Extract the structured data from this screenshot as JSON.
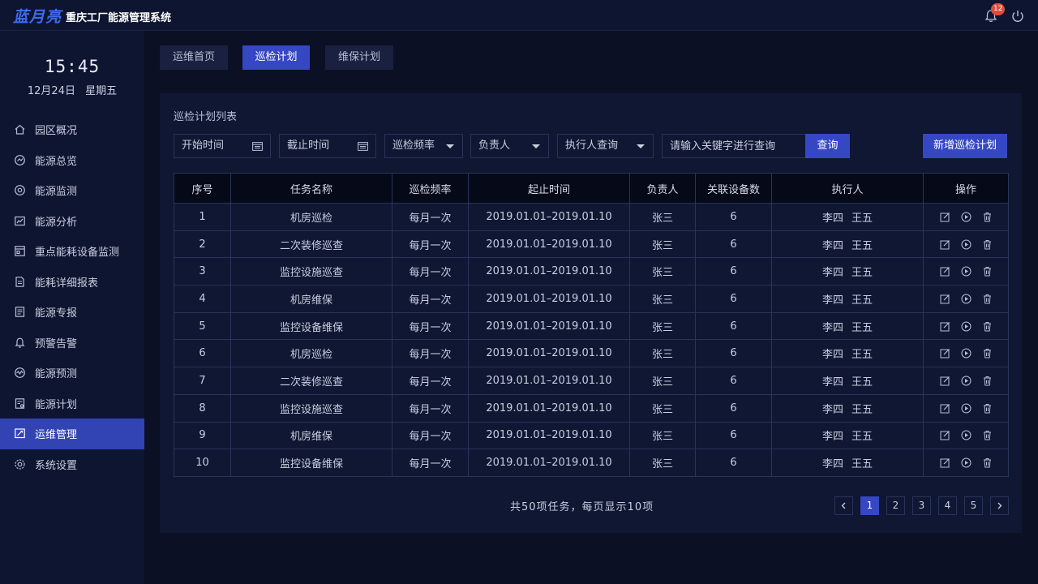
{
  "header": {
    "logo": "蓝月亮",
    "title": "重庆工厂能源管理系统",
    "notification_count": "12"
  },
  "sidebar": {
    "clock": "15:45",
    "date": "12月24日 星期五",
    "items": [
      {
        "label": "园区概况",
        "icon": "home-icon",
        "active": false
      },
      {
        "label": "能源总览",
        "icon": "overview-icon",
        "active": false
      },
      {
        "label": "能源监测",
        "icon": "monitor-icon",
        "active": false
      },
      {
        "label": "能源分析",
        "icon": "analysis-icon",
        "active": false
      },
      {
        "label": "重点能耗设备监测",
        "icon": "equipment-icon",
        "active": false
      },
      {
        "label": "能耗详细报表",
        "icon": "report-icon",
        "active": false
      },
      {
        "label": "能源专报",
        "icon": "doc-icon",
        "active": false
      },
      {
        "label": "预警告警",
        "icon": "alarm-icon",
        "active": false
      },
      {
        "label": "能源预测",
        "icon": "forecast-icon",
        "active": false
      },
      {
        "label": "能源计划",
        "icon": "plan-icon",
        "active": false
      },
      {
        "label": "运维管理",
        "icon": "maintenance-icon",
        "active": true
      },
      {
        "label": "系统设置",
        "icon": "settings-icon",
        "active": false
      }
    ]
  },
  "tabs": [
    {
      "label": "运维首页",
      "active": false
    },
    {
      "label": "巡检计划",
      "active": true
    },
    {
      "label": "维保计划",
      "active": false
    }
  ],
  "panel": {
    "title": "巡检计划列表",
    "filters": {
      "start_time": "开始时间",
      "end_time": "截止时间",
      "frequency": "巡检频率",
      "owner": "负责人",
      "executor": "执行人查询",
      "search_placeholder": "请输入关键字进行查询",
      "search_button": "查询",
      "add_button": "新增巡检计划"
    },
    "table": {
      "headers": [
        "序号",
        "任务名称",
        "巡检频率",
        "起止时间",
        "负责人",
        "关联设备数",
        "执行人",
        "操作"
      ],
      "rows": [
        {
          "no": "1",
          "name": "机房巡检",
          "freq": "每月一次",
          "period": "2019.01.01–2019.01.10",
          "owner": "张三",
          "devices": "6",
          "executors": [
            "李四",
            "王五"
          ]
        },
        {
          "no": "2",
          "name": "二次装修巡查",
          "freq": "每月一次",
          "period": "2019.01.01–2019.01.10",
          "owner": "张三",
          "devices": "6",
          "executors": [
            "李四",
            "王五"
          ]
        },
        {
          "no": "3",
          "name": "监控设施巡查",
          "freq": "每月一次",
          "period": "2019.01.01–2019.01.10",
          "owner": "张三",
          "devices": "6",
          "executors": [
            "李四",
            "王五"
          ]
        },
        {
          "no": "4",
          "name": "机房维保",
          "freq": "每月一次",
          "period": "2019.01.01–2019.01.10",
          "owner": "张三",
          "devices": "6",
          "executors": [
            "李四",
            "王五"
          ]
        },
        {
          "no": "5",
          "name": "监控设备维保",
          "freq": "每月一次",
          "period": "2019.01.01–2019.01.10",
          "owner": "张三",
          "devices": "6",
          "executors": [
            "李四",
            "王五"
          ]
        },
        {
          "no": "6",
          "name": "机房巡检",
          "freq": "每月一次",
          "period": "2019.01.01–2019.01.10",
          "owner": "张三",
          "devices": "6",
          "executors": [
            "李四",
            "王五"
          ]
        },
        {
          "no": "7",
          "name": "二次装修巡查",
          "freq": "每月一次",
          "period": "2019.01.01–2019.01.10",
          "owner": "张三",
          "devices": "6",
          "executors": [
            "李四",
            "王五"
          ]
        },
        {
          "no": "8",
          "name": "监控设施巡查",
          "freq": "每月一次",
          "period": "2019.01.01–2019.01.10",
          "owner": "张三",
          "devices": "6",
          "executors": [
            "李四",
            "王五"
          ]
        },
        {
          "no": "9",
          "name": "机房维保",
          "freq": "每月一次",
          "period": "2019.01.01–2019.01.10",
          "owner": "张三",
          "devices": "6",
          "executors": [
            "李四",
            "王五"
          ]
        },
        {
          "no": "10",
          "name": "监控设备维保",
          "freq": "每月一次",
          "period": "2019.01.01–2019.01.10",
          "owner": "张三",
          "devices": "6",
          "executors": [
            "李四",
            "王五"
          ]
        }
      ]
    },
    "summary": "共50项任务，每页显示10项",
    "pagination": {
      "pages": [
        "1",
        "2",
        "3",
        "4",
        "5"
      ],
      "current": "1"
    }
  },
  "colors": {
    "background": "#0b1024",
    "panel": "#0f1733",
    "accent": "#3647c4",
    "badge": "#e14b3b",
    "logo": "#3e6cf0"
  }
}
